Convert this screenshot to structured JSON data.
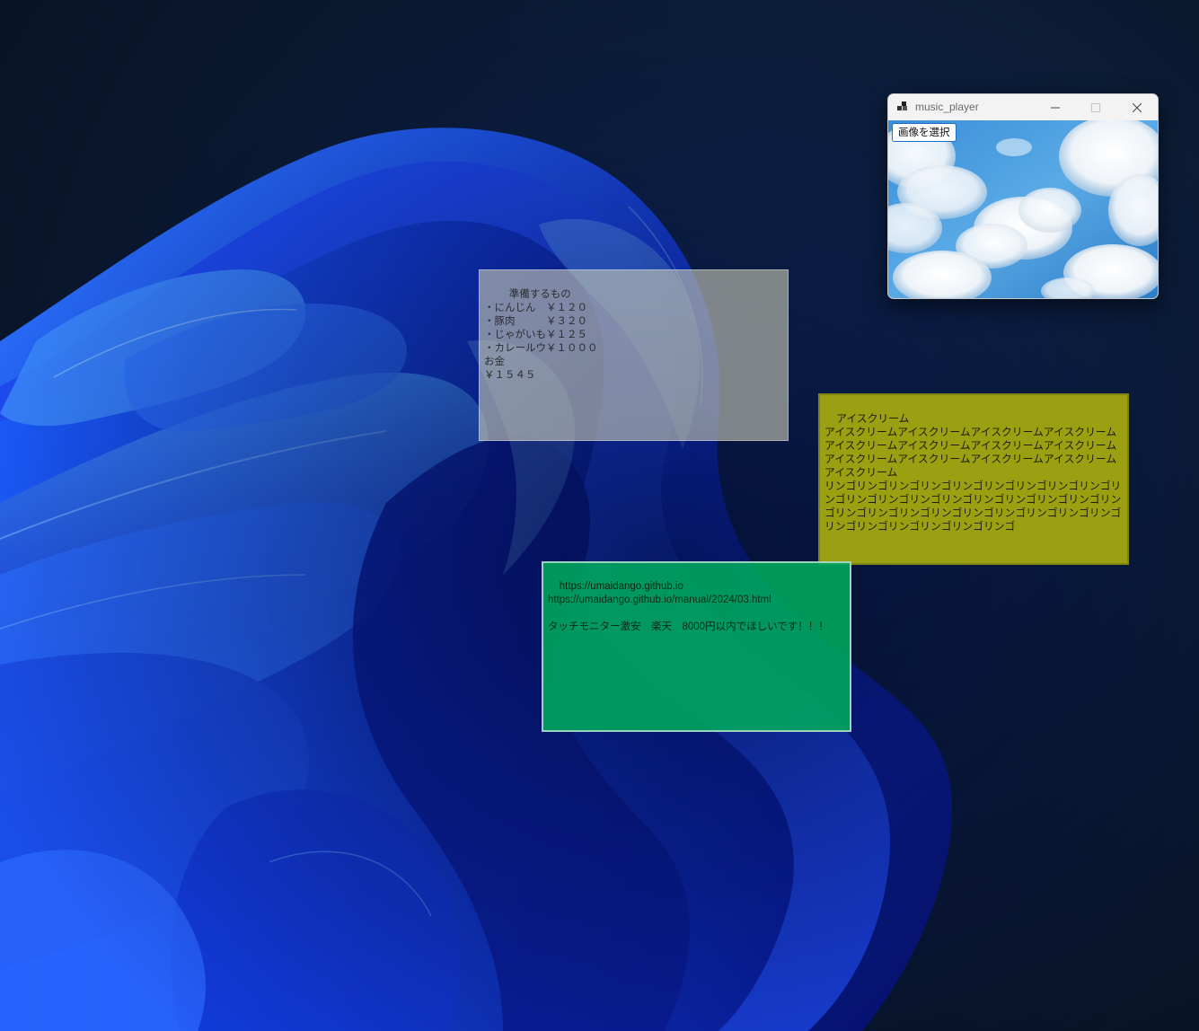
{
  "desktop": {
    "wallpaper": "windows-11-bloom-blue",
    "colors": {
      "background": "#0b1b33",
      "bloom": "#1a3cf0",
      "bloom_highlight": "#4a8cff"
    }
  },
  "sticky_notes": {
    "memo": {
      "text": "準備するもの\n・にんじん　￥１２０\n・豚肉　　　￥３２０\n・じゃがいも￥１２５\n・カレールウ￥１０００\nお金\n￥１５４５",
      "color": "#c8c8b4"
    },
    "icecream": {
      "text": "アイスクリーム\nアイスクリームアイスクリームアイスクリームアイスクリームアイスクリームアイスクリームアイスクリームアイスクリームアイスクリームアイスクリームアイスクリームアイスクリームアイスクリーム\nリンゴリンゴリンゴリンゴリンゴリンゴリンゴリンゴリンゴリンゴリンゴリンゴリンゴリンゴリンゴリンゴリンゴリンゴリンゴリンゴリンゴリンゴリンゴリンゴリンゴリンゴリンゴリンゴリンゴリンゴリンゴリンゴリンゴリンゴ",
      "color": "#9aa011"
    },
    "links": {
      "text": "https://umaidango.github.io\nhttps://umaidango.github.io/manual/2024/03.html\n\nタッチモニター激安　楽天　8000円以内でほしいです！！！",
      "color": "#00aa5f"
    }
  },
  "music_player": {
    "title": "music_player",
    "select_image_label": "画像を選択",
    "icons": {
      "app": "app-icon",
      "minimize": "minimize-icon",
      "maximize": "maximize-icon",
      "close": "close-icon"
    },
    "image": "sky-with-clouds"
  }
}
